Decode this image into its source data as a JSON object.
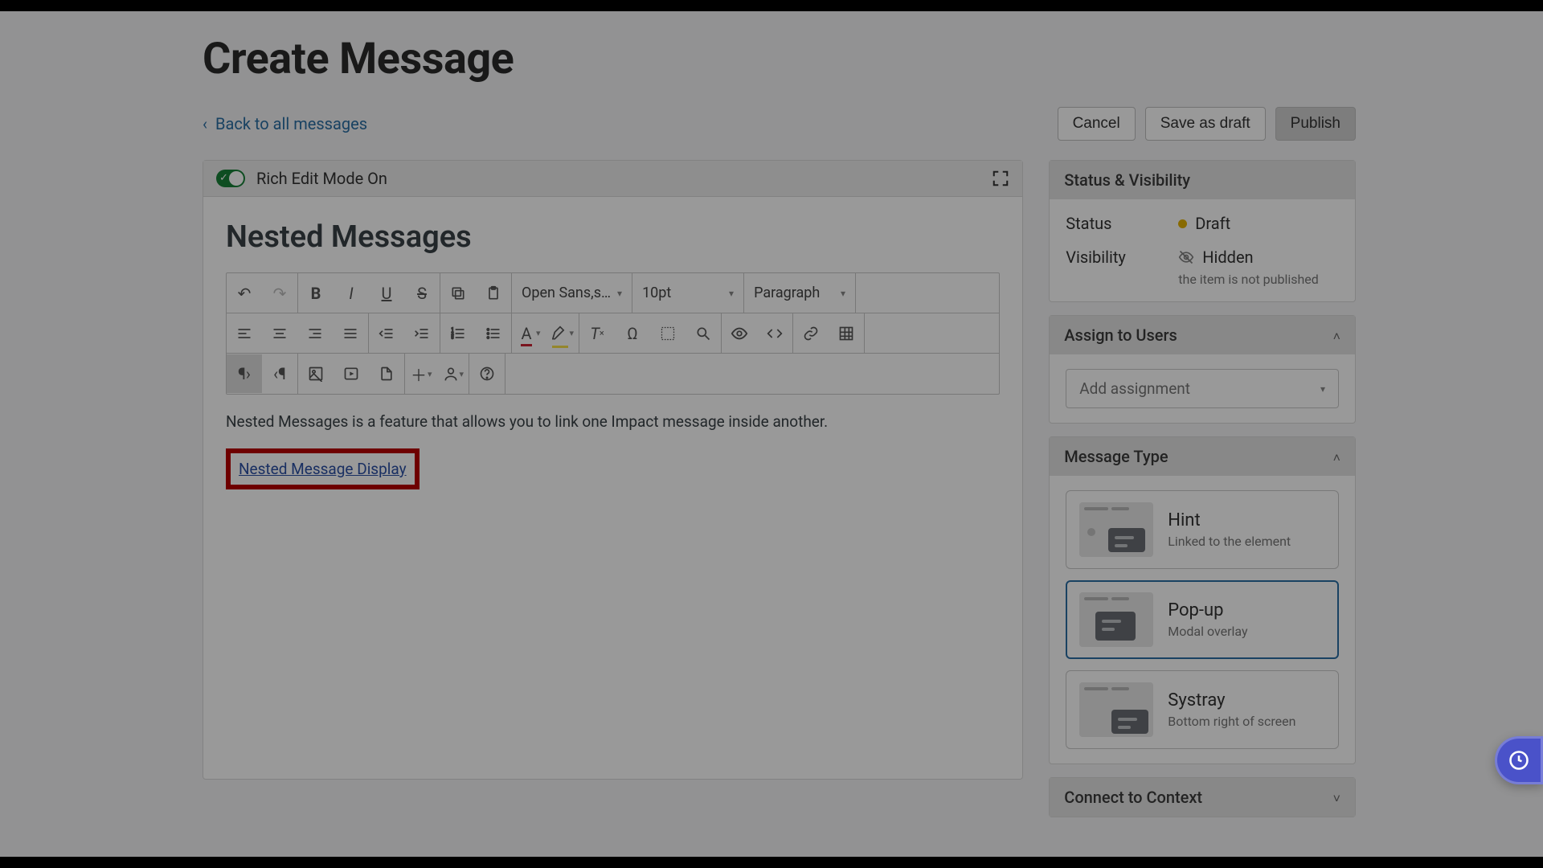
{
  "page": {
    "title": "Create Message",
    "back_link": "Back to all messages"
  },
  "actions": {
    "cancel": "Cancel",
    "save_draft": "Save as draft",
    "publish": "Publish"
  },
  "editor": {
    "rich_mode_label": "Rich Edit Mode On",
    "article_title": "Nested Messages",
    "body_text": "Nested Messages is a feature that allows you to link one Impact message inside another.",
    "nested_link_text": "Nested Message Display",
    "toolbar": {
      "font_family": "Open Sans,s…",
      "font_size": "10pt",
      "block_format": "Paragraph"
    }
  },
  "sidebar": {
    "status_visibility": {
      "header": "Status & Visibility",
      "status_label": "Status",
      "status_value": "Draft",
      "visibility_label": "Visibility",
      "visibility_value": "Hidden",
      "visibility_hint": "the item is not published"
    },
    "assign_users": {
      "header": "Assign to Users",
      "placeholder": "Add assignment"
    },
    "message_type": {
      "header": "Message Type",
      "options": [
        {
          "title": "Hint",
          "desc": "Linked to the element"
        },
        {
          "title": "Pop-up",
          "desc": "Modal overlay"
        },
        {
          "title": "Systray",
          "desc": "Bottom right of screen"
        }
      ],
      "selected_index": 1
    },
    "connect_context": {
      "header": "Connect to Context"
    }
  }
}
